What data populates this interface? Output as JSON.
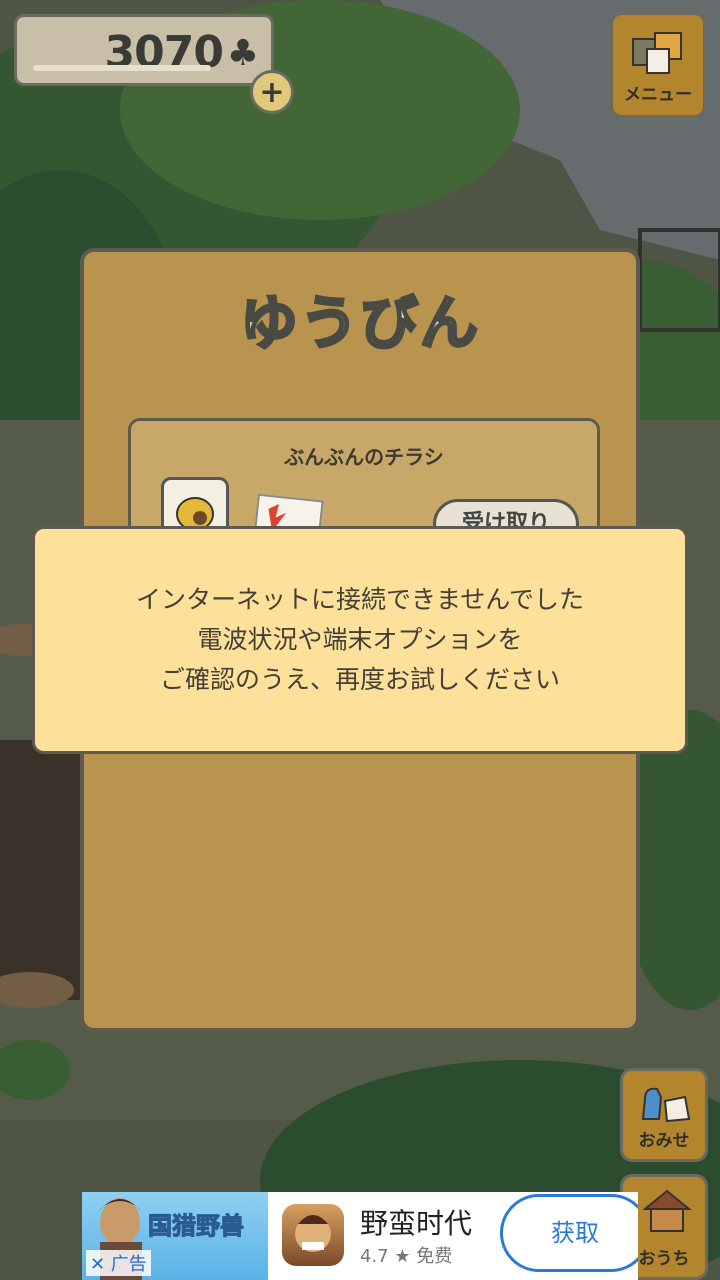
{
  "header": {
    "clover_amount": "3070",
    "clover_symbol": "♣",
    "plus_label": "+",
    "menu_label": "メニュー"
  },
  "mail_panel": {
    "title": "ゆうびん",
    "item": {
      "title": "ぶんぶんのチラシ",
      "receive_label": "受け取り"
    }
  },
  "error_dialog": {
    "lines": [
      "インターネットに接続できませんでした",
      "電波状況や端末オプションを",
      "ご確認のうえ、再度お試しください"
    ]
  },
  "side_buttons": {
    "shop_label": "おみせ",
    "home_label": "おうち"
  },
  "ad": {
    "banner_game_name": "国猎野兽",
    "close_label": "✕ 广告",
    "app_name": "野蛮时代",
    "rating": "4.7 ★ 免费",
    "get_label": "获取"
  },
  "colors": {
    "panel": "#b8944e",
    "dialog": "#fde09a",
    "button": "#b3862e",
    "ad_accent": "#2a7ad8"
  }
}
